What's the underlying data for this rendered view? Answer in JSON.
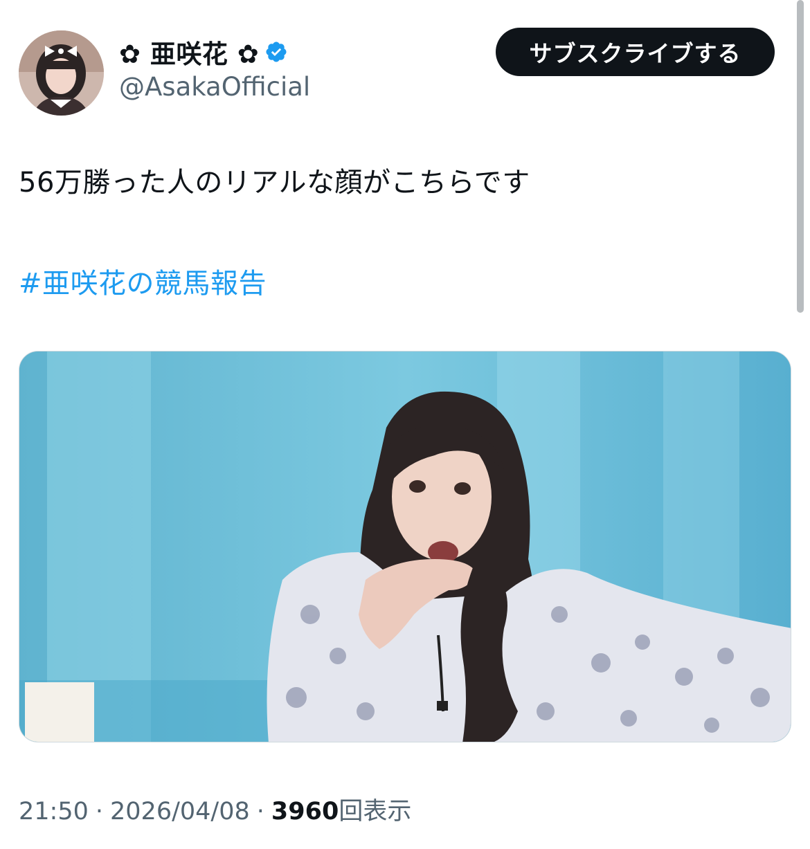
{
  "user": {
    "display_name": "✿ 亜咲花 ✿",
    "handle": "@AsakaOfficial",
    "verified": true
  },
  "subscribe_button": {
    "label": "サブスクライブする"
  },
  "tweet": {
    "text": "56万勝った人のリアルな顔がこちらです",
    "hashtag": "#亜咲花の競馬報告"
  },
  "meta": {
    "time": "21:50",
    "separator": "·",
    "date": "2026/04/08",
    "views_count": "3960",
    "views_label": "回表示"
  },
  "colors": {
    "accent": "#1d9bf0",
    "button_bg": "#0f1419",
    "secondary_text": "#536471"
  }
}
